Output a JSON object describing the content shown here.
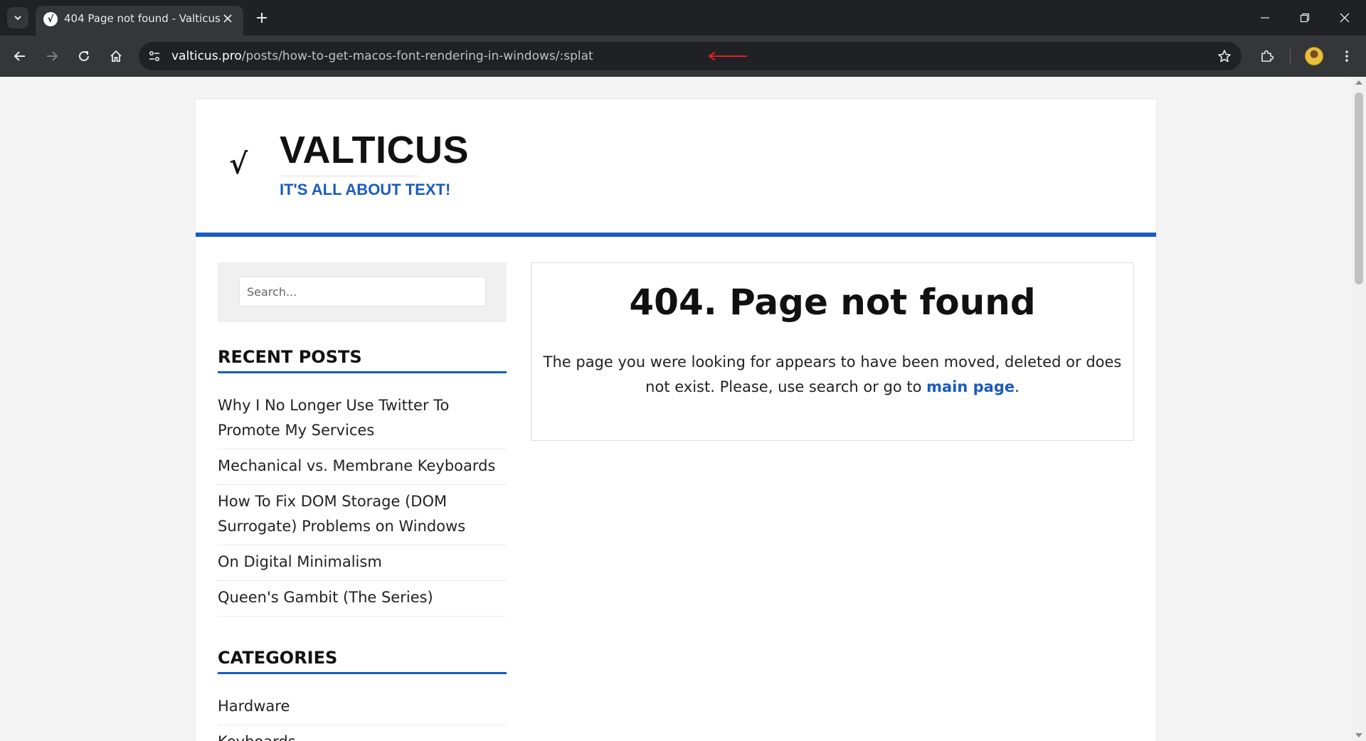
{
  "browser": {
    "tab_title": "404 Page not found - Valticus",
    "favicon_glyph": "√",
    "url_host": "valticus.pro",
    "url_path": "/posts/how-to-get-macos-font-rendering-in-windows/:splat"
  },
  "site": {
    "logo_glyph": "√",
    "title": "VALTICUS",
    "tagline": "IT'S ALL ABOUT TEXT!",
    "accent_color": "#1a5bbf"
  },
  "sidebar": {
    "search_placeholder": "Search...",
    "recent_posts_title": "RECENT POSTS",
    "recent_posts": [
      "Why I No Longer Use Twitter To Promote My Services",
      "Mechanical vs. Membrane Keyboards",
      "How To Fix DOM Storage (DOM Surrogate) Problems on Windows",
      "On Digital Minimalism",
      "Queen's Gambit (The Series)"
    ],
    "categories_title": "CATEGORIES",
    "categories": [
      "Hardware",
      "Keyboards"
    ]
  },
  "main": {
    "heading": "404. Page not found",
    "text_before": "The page you were looking for appears to have been moved, deleted or does not exist. Please, use search or go to ",
    "link_text": "main page",
    "text_after": "."
  }
}
